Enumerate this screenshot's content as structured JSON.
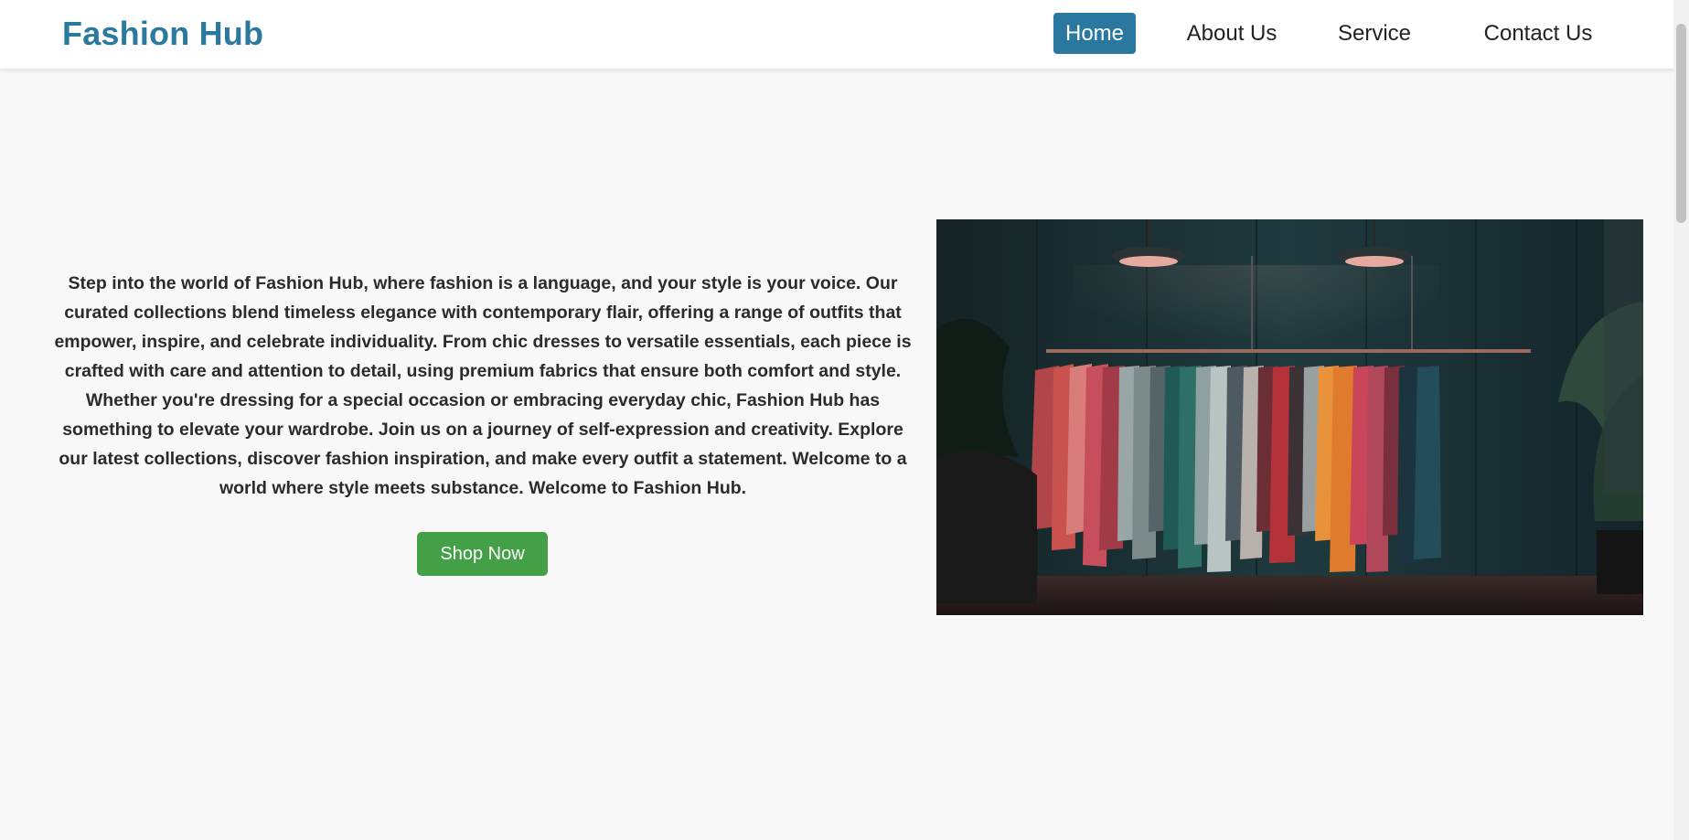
{
  "header": {
    "logo": "Fashion Hub",
    "nav": [
      {
        "label": "Home",
        "active": true
      },
      {
        "label": "About Us",
        "active": false
      },
      {
        "label": "Service",
        "active": false
      },
      {
        "label": "Contact Us",
        "active": false
      }
    ]
  },
  "hero": {
    "text": "Step into the world of Fashion Hub, where fashion is a language, and your style is your voice. Our curated collections blend timeless elegance with contemporary flair, offering a range of outfits that empower, inspire, and celebrate individuality. From chic dresses to versatile essentials, each piece is crafted with care and attention to detail, using premium fabrics that ensure both comfort and style. Whether you're dressing for a special occasion or embracing everyday chic, Fashion Hub has something to elevate your wardrobe. Join us on a journey of self-expression and creativity. Explore our latest collections, discover fashion inspiration, and make every outfit a statement. Welcome to a world where style meets substance. Welcome to Fashion Hub.",
    "button_label": "Shop Now",
    "image_subject": "clothing-rack-photo"
  },
  "colors": {
    "brand": "#2b7a9e",
    "nav_active_bg": "#2a78a0",
    "shop_button": "#43a047",
    "page_bg": "#f8f8f8"
  }
}
